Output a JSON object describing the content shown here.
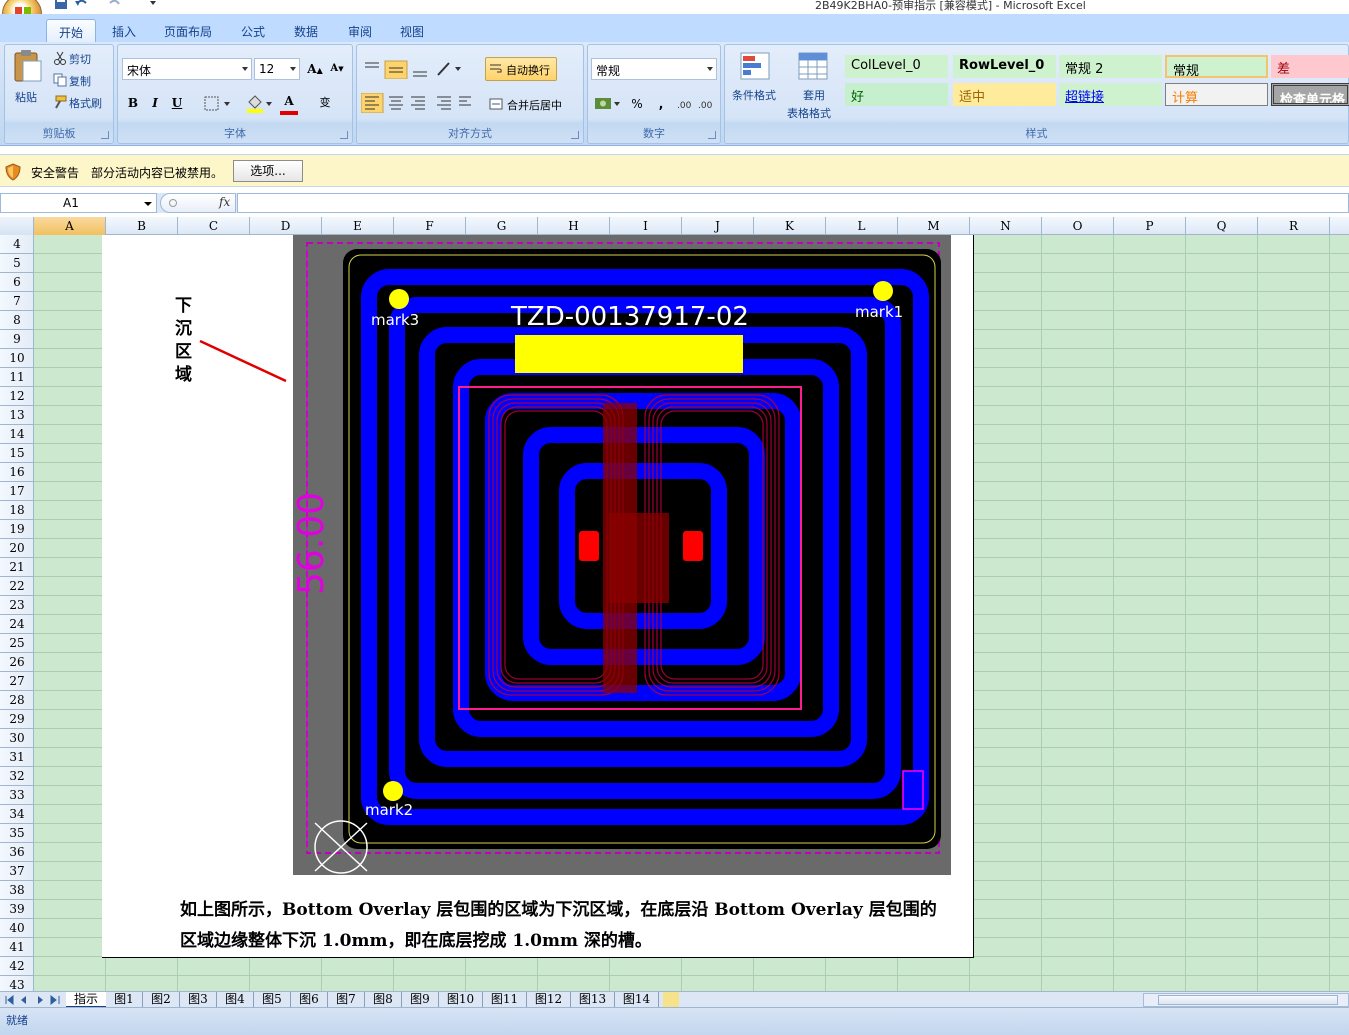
{
  "window": {
    "title": "2B49K2BHA0-预审指示 [兼容模式] - Microsoft Excel"
  },
  "ribbon": {
    "tabs": [
      "开始",
      "插入",
      "页面布局",
      "公式",
      "数据",
      "审阅",
      "视图"
    ],
    "active_tab": "开始",
    "clipboard": {
      "paste": "粘贴",
      "cut": "剪切",
      "copy": "复制",
      "format_painter": "格式刷",
      "label": "剪贴板"
    },
    "font": {
      "name": "宋体",
      "size": "12",
      "label": "字体",
      "bold": "B",
      "italic": "I",
      "underline": "U",
      "font_color_glyph": "A",
      "wen_glyph": "变"
    },
    "alignment": {
      "wrap": "自动换行",
      "merge": "合并后居中",
      "label": "对齐方式"
    },
    "number": {
      "format": "常规",
      "percent": "%",
      "comma": ",",
      "label": "数字"
    },
    "styles": {
      "conditional": "条件格式",
      "table_format_1": "套用",
      "table_format_2": "表格格式",
      "label": "样式",
      "cells": [
        {
          "text": "ColLevel_0",
          "bg": "#cdf2cd",
          "color": "#000000"
        },
        {
          "text": "RowLevel_0",
          "bg": "#cdf2cd",
          "color": "#000000"
        },
        {
          "text": "常规 2",
          "bg": "#cdf2cd",
          "color": "#000000"
        },
        {
          "text": "常规",
          "bg": "#cdf2cd",
          "color": "#000000"
        },
        {
          "text": "差",
          "bg": "#ffc7ce",
          "color": "#9c0006"
        },
        {
          "text": "好",
          "bg": "#c6efce",
          "color": "#006100"
        },
        {
          "text": "适中",
          "bg": "#ffeb9c",
          "color": "#9c6500"
        },
        {
          "text": "超链接",
          "bg": "#cdf2cd",
          "color": "#0000ff"
        },
        {
          "text": "计算",
          "bg": "#f2f2f2",
          "color": "#fa7d00"
        },
        {
          "text": "检查单元格",
          "bg": "#a5a5a5",
          "color": "#ffffff"
        }
      ]
    }
  },
  "security": {
    "title": "安全警告",
    "message": "部分活动内容已被禁用。",
    "options_button": "选项..."
  },
  "formula_bar": {
    "name_box": "A1",
    "fx": "fx",
    "formula": ""
  },
  "grid": {
    "columns": [
      "A",
      "B",
      "C",
      "D",
      "E",
      "F",
      "G",
      "H",
      "I",
      "J",
      "K",
      "L",
      "M",
      "N",
      "O",
      "P",
      "Q",
      "R"
    ],
    "selected_column": "A",
    "rows": [
      "4",
      "5",
      "6",
      "7",
      "8",
      "9",
      "10",
      "11",
      "12",
      "13",
      "14",
      "15",
      "16",
      "17",
      "18",
      "19",
      "20",
      "21",
      "22",
      "23",
      "24",
      "25",
      "26",
      "27",
      "28",
      "29",
      "30",
      "31",
      "32",
      "33",
      "34",
      "35",
      "36",
      "37",
      "38",
      "39",
      "40",
      "41",
      "42",
      "43"
    ]
  },
  "content": {
    "annotation": [
      "下",
      "沉",
      "区",
      "域"
    ],
    "board": {
      "code": "TZD-00137917-02",
      "mark1": "mark1",
      "mark2": "mark2",
      "mark3": "mark3",
      "dimension": "56.00"
    },
    "caption_line1": "如上图所示，Bottom Overlay 层包围的区域为下沉区域，在底层沿 Bottom Overlay 层包围的",
    "caption_line2": "区域边缘整体下沉 1.0mm，即在底层挖成 1.0mm 深的槽。"
  },
  "sheets": [
    "指示",
    "图1",
    "图2",
    "图3",
    "图4",
    "图5",
    "图6",
    "图7",
    "图8",
    "图9",
    "图10",
    "图11",
    "图12",
    "图13",
    "图14"
  ],
  "active_sheet": "指示",
  "status": {
    "ready": "就绪"
  }
}
